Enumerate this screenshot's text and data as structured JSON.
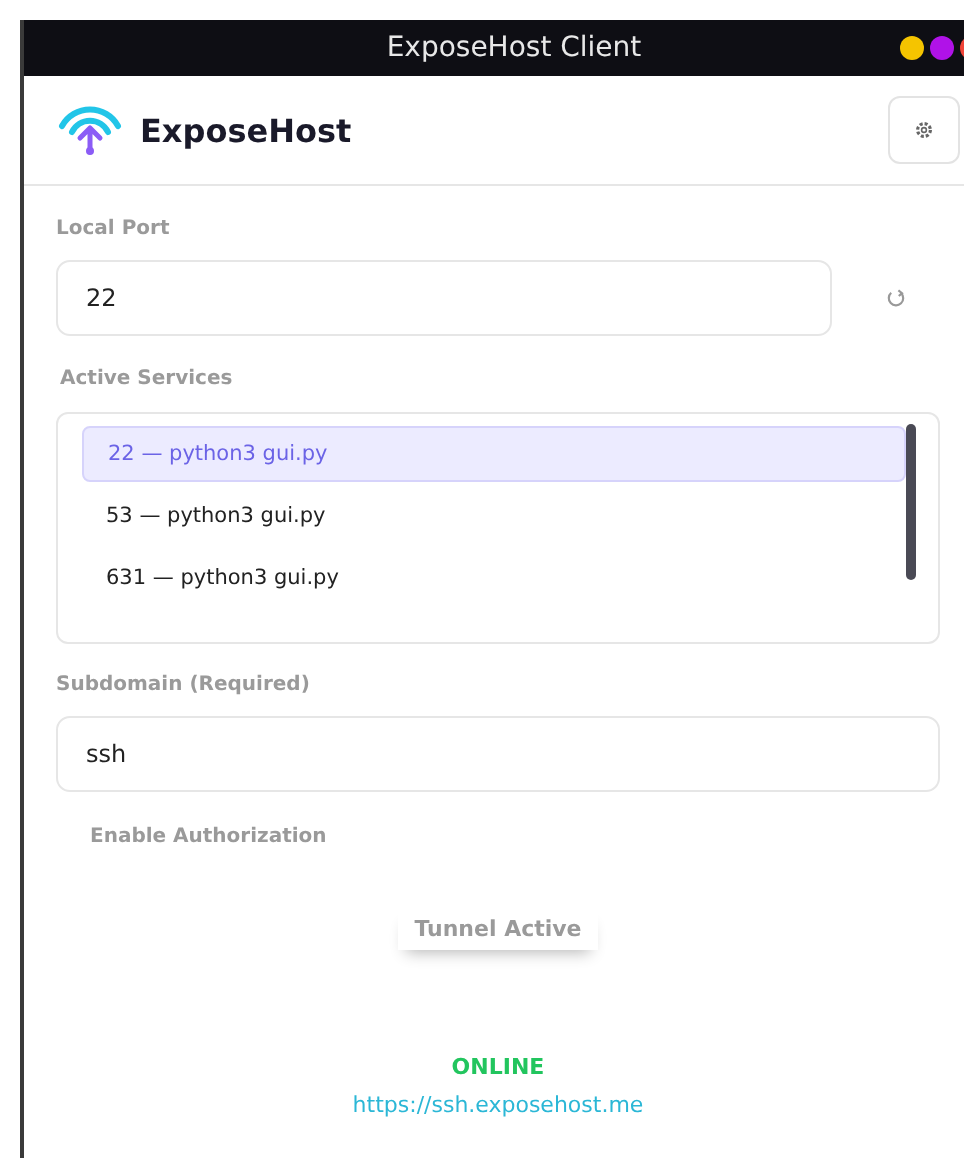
{
  "window": {
    "title": "ExposeHost Client"
  },
  "header": {
    "app_name": "ExposeHost"
  },
  "local_port": {
    "label": "Local Port",
    "value": "22"
  },
  "active_services": {
    "label": "Active Services",
    "items": [
      {
        "label": "22 — python3 gui.py",
        "selected": true
      },
      {
        "label": "53 — python3 gui.py",
        "selected": false
      },
      {
        "label": "631 — python3 gui.py",
        "selected": false
      }
    ]
  },
  "subdomain": {
    "label": "Subdomain (Required)",
    "value": "ssh"
  },
  "authorization": {
    "label": "Enable Authorization"
  },
  "tunnel_button": {
    "label": "Tunnel Active",
    "disabled": true
  },
  "status": {
    "text": "ONLINE",
    "color": "#22c55e",
    "url": "https://ssh.exposehost.me"
  }
}
